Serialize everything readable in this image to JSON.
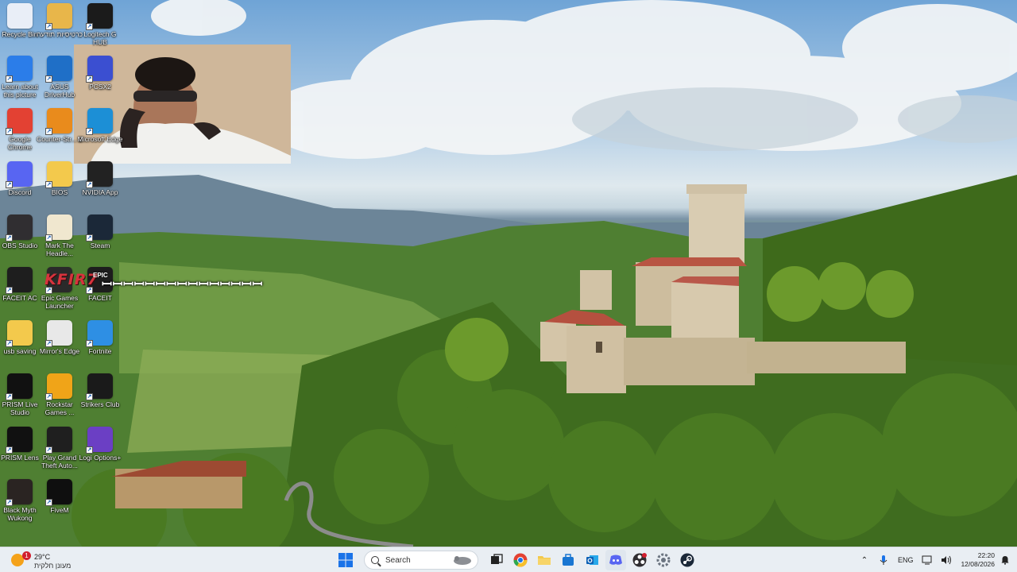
{
  "desktop": {
    "icons": [
      {
        "label": "Recycle Bin",
        "icon": "recycle-bin-icon",
        "color": "#e9eef7"
      },
      {
        "label": "כרטיסיות תודעה",
        "icon": "folder-shortcut-icon",
        "color": "#e8b64a"
      },
      {
        "label": "Logitech G HUB",
        "icon": "logitech-g-icon",
        "color": "#1b1b1b"
      },
      {
        "label": "Learn about this picture",
        "icon": "learn-picture-icon",
        "color": "#2b7de9"
      },
      {
        "label": "ASUS DriverHub",
        "icon": "asus-gear-icon",
        "color": "#1f6fc7"
      },
      {
        "label": "PCSX2",
        "icon": "pcsx2-icon",
        "color": "#3b4fd1"
      },
      {
        "label": "Google Chrome",
        "icon": "chrome-icon",
        "color": "#e34133"
      },
      {
        "label": "Counter-Str... 2",
        "icon": "counter-strike-icon",
        "color": "#e98b1c"
      },
      {
        "label": "Microsoft Edge",
        "icon": "edge-icon",
        "color": "#1c8fd6"
      },
      {
        "label": "Discord",
        "icon": "discord-icon",
        "color": "#5865f2"
      },
      {
        "label": "BIOS",
        "icon": "folder-icon",
        "color": "#f3c94c"
      },
      {
        "label": "NVIDIA App",
        "icon": "nvidia-icon",
        "color": "#222222"
      },
      {
        "label": "OBS Studio",
        "icon": "obs-icon",
        "color": "#302e31"
      },
      {
        "label": "Mark The Headle...",
        "icon": "cartoon-icon",
        "color": "#f0e7cf"
      },
      {
        "label": "Steam",
        "icon": "steam-icon",
        "color": "#1b2838"
      },
      {
        "label": "FACEIT AC",
        "icon": "faceit-ac-icon",
        "color": "#1e1e1e"
      },
      {
        "label": "Epic Games Launcher",
        "icon": "epic-games-icon",
        "color": "#2a2a2a"
      },
      {
        "label": "FACEIT",
        "icon": "faceit-icon",
        "color": "#1d1d1d"
      },
      {
        "label": "usb saving",
        "icon": "folder-icon",
        "color": "#f3c94c"
      },
      {
        "label": "Mirror's Edge",
        "icon": "mirrors-edge-icon",
        "color": "#e8e8e8"
      },
      {
        "label": "Fortnite",
        "icon": "fortnite-icon",
        "color": "#2e8fe4"
      },
      {
        "label": "PRISM Live Studio",
        "icon": "prism-live-icon",
        "color": "#111111"
      },
      {
        "label": "Rockstar Games ...",
        "icon": "rockstar-icon",
        "color": "#f0a418"
      },
      {
        "label": "Strikers Club",
        "icon": "strikers-club-icon",
        "color": "#1a1a1a"
      },
      {
        "label": "PRISM Lens",
        "icon": "prism-lens-icon",
        "color": "#111111"
      },
      {
        "label": "Play Grand Theft Auto...",
        "icon": "gta-icon",
        "color": "#1f1f1f"
      },
      {
        "label": "Logi Options+",
        "icon": "logi-options-icon",
        "color": "#6b3fc4"
      },
      {
        "label": "Black Myth Wukong",
        "icon": "black-myth-icon",
        "color": "#2a2422"
      },
      {
        "label": "FiveM",
        "icon": "fivem-icon",
        "color": "#0f0f0f"
      }
    ],
    "overlay_text": "KFIR7",
    "epic_text": "EPIC",
    "glitch_text": "ꟷꟷꟷꟷꟷꟷꟷꟷꟷꟷꟷꟷꟷꟷꟷ"
  },
  "taskbar": {
    "weather": {
      "badge": "1",
      "temp": "29°C",
      "condition": "מעונן חלקית"
    },
    "search_placeholder": "Search",
    "pinned": [
      {
        "name": "start-button",
        "icon": "windows-start-icon",
        "color": "#1a73e8"
      },
      {
        "name": "task-view-button",
        "icon": "task-view-icon",
        "color": "#222222"
      },
      {
        "name": "chrome-taskbar",
        "icon": "chrome-icon",
        "color": "#e34133"
      },
      {
        "name": "file-explorer-taskbar",
        "icon": "file-explorer-icon",
        "color": "#f3c94c"
      },
      {
        "name": "store-taskbar",
        "icon": "store-icon",
        "color": "#1976d2"
      },
      {
        "name": "outlook-taskbar",
        "icon": "outlook-icon",
        "color": "#0f62b6"
      },
      {
        "name": "discord-taskbar",
        "icon": "discord-icon",
        "color": "#5865f2"
      },
      {
        "name": "obs-taskbar",
        "icon": "obs-icon",
        "color": "#302e31"
      },
      {
        "name": "settings-taskbar",
        "icon": "settings-gear-icon",
        "color": "#6b7480"
      },
      {
        "name": "steam-taskbar",
        "icon": "steam-icon",
        "color": "#1b2838"
      }
    ],
    "tray": {
      "language": "ENG",
      "time": "22:20",
      "date": "12/08/2026"
    }
  }
}
